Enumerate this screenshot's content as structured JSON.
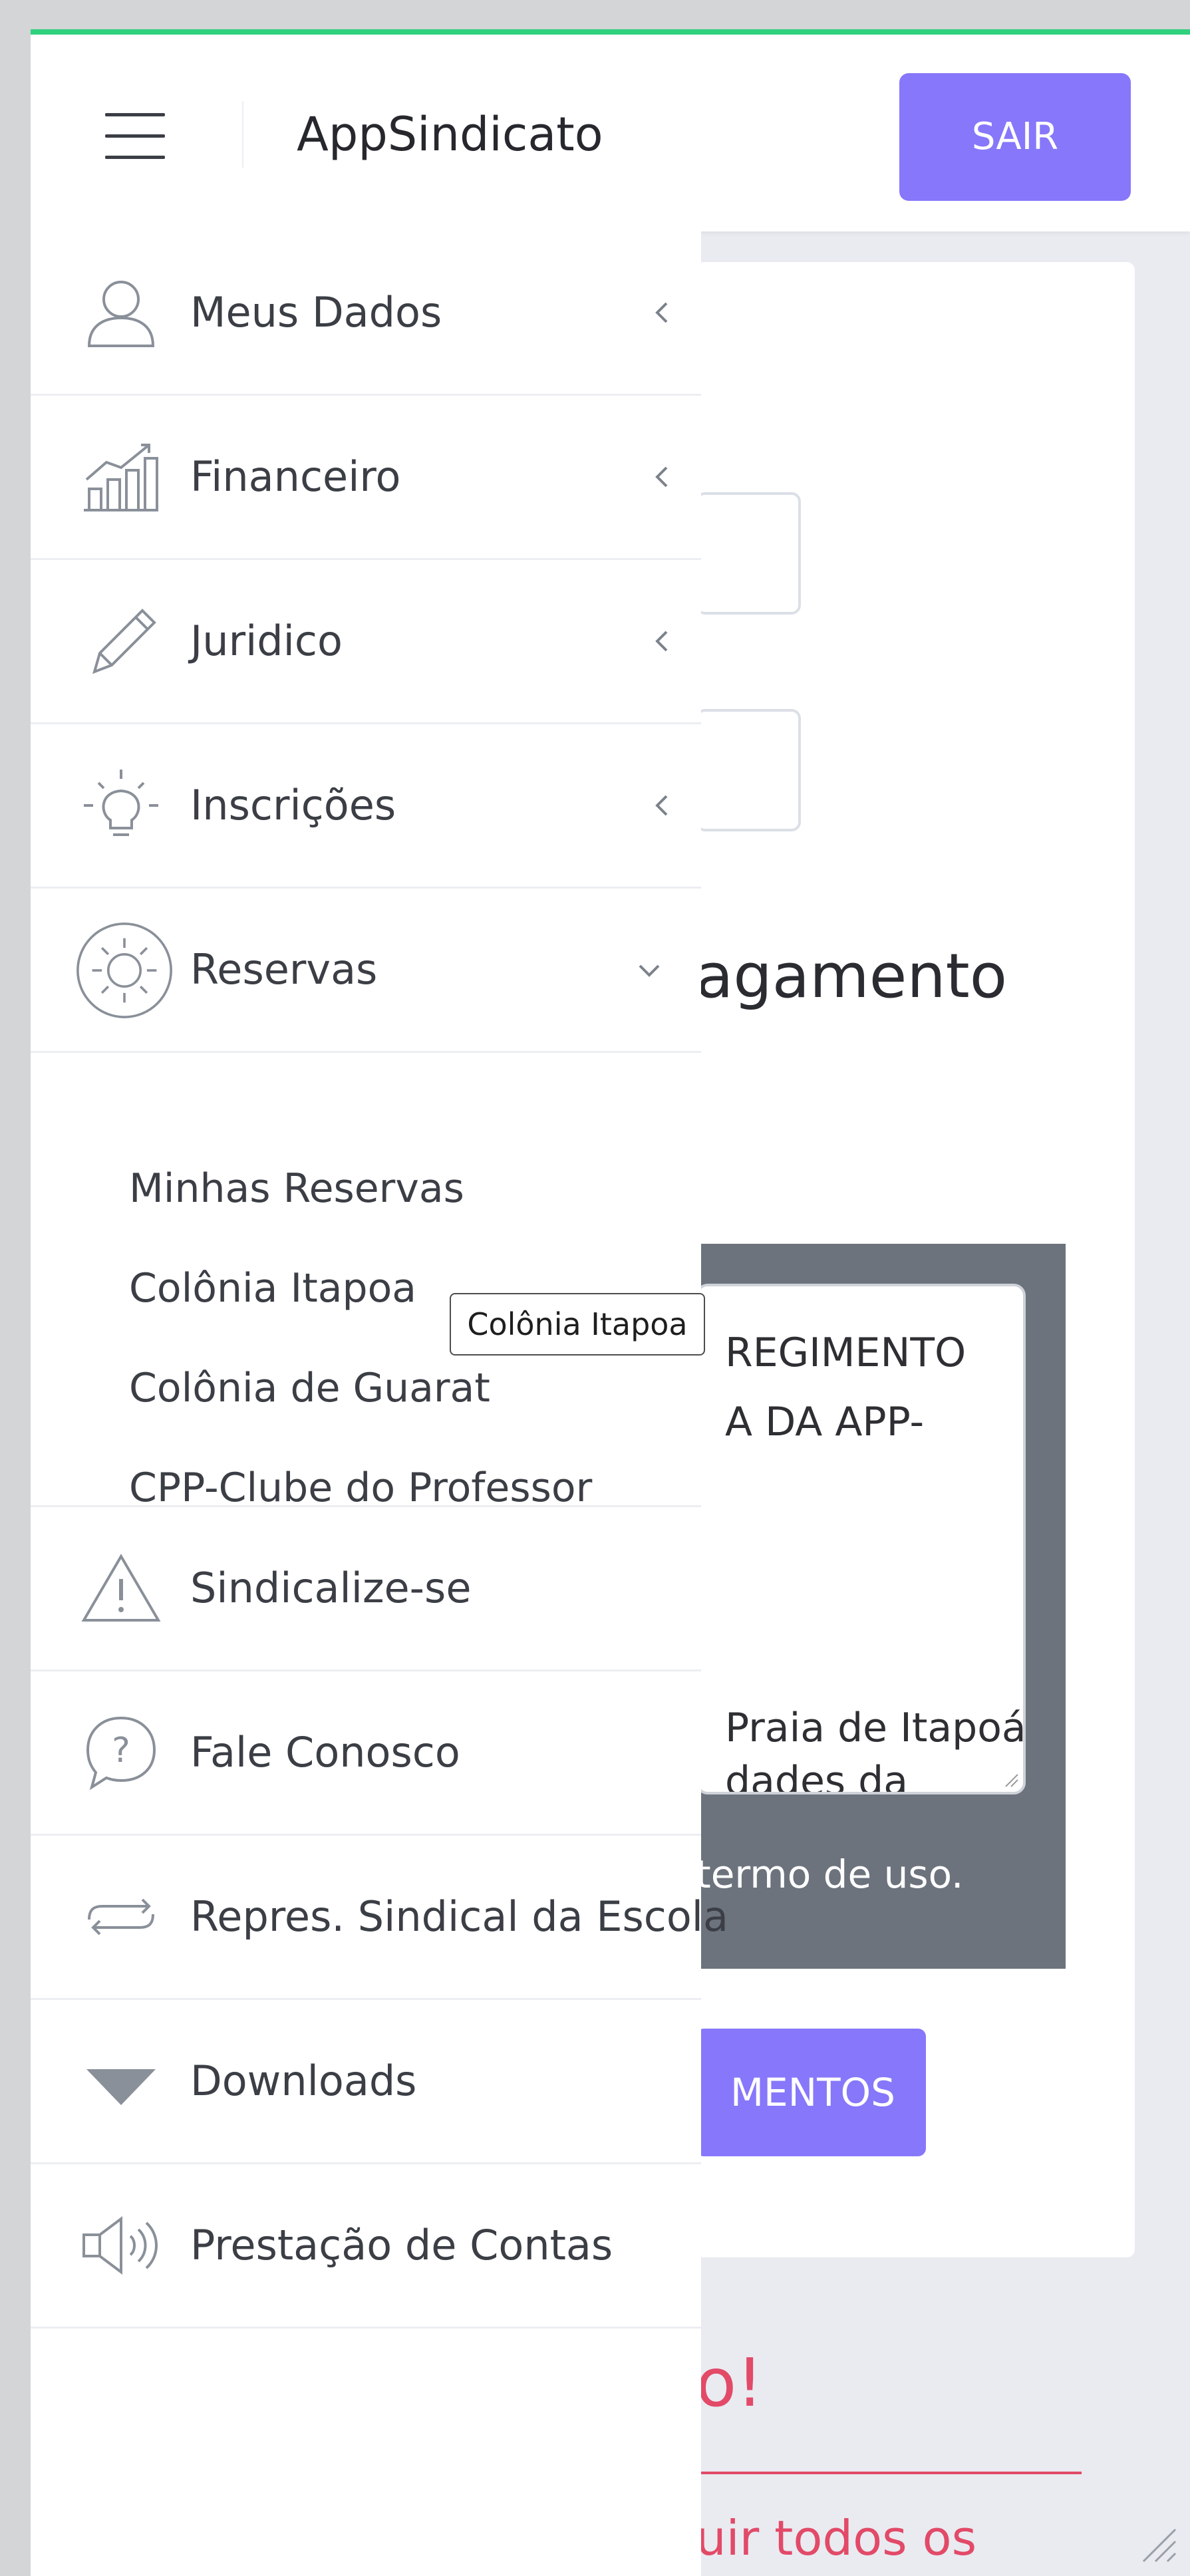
{
  "header": {
    "brand": "AppSindicato",
    "logout_label": "SAIR"
  },
  "sidebar": {
    "items": [
      {
        "label": "Meus Dados",
        "icon": "user-icon"
      },
      {
        "label": "Financeiro",
        "icon": "chart-icon"
      },
      {
        "label": "Juridico",
        "icon": "pencil-icon"
      },
      {
        "label": "Inscrições",
        "icon": "lightbulb-icon"
      },
      {
        "label": "Reservas",
        "icon": "sun-icon"
      },
      {
        "label": "Sindicalize-se",
        "icon": "warning-icon"
      },
      {
        "label": "Fale Conosco",
        "icon": "question-icon"
      },
      {
        "label": "Repres. Sindical da Escola",
        "icon": "exchange-icon"
      },
      {
        "label": "Downloads",
        "icon": "triangle-down-icon"
      },
      {
        "label": "Prestação de Contas",
        "icon": "megaphone-icon"
      }
    ],
    "reservas_subitems": [
      "Minhas Reservas",
      "Colônia Itapoa",
      "Colônia de Guarat",
      "CPP-Clube do Professor"
    ]
  },
  "tooltip": "Colônia Itapoa",
  "background": {
    "title_fragment": "agamento",
    "textarea_lines": [
      "REGIMENTO",
      "A DA APP-",
      "Praia de Itapoá",
      "dades da"
    ],
    "terms_fragment": "termo de uso.",
    "button_fragment": "MENTOS",
    "alert_title_fragment": "o!",
    "alert_text_fragment": "uir todos os"
  },
  "colors": {
    "accent": "#8677fb",
    "topline": "#2fd17d",
    "alert": "#e24a68"
  }
}
